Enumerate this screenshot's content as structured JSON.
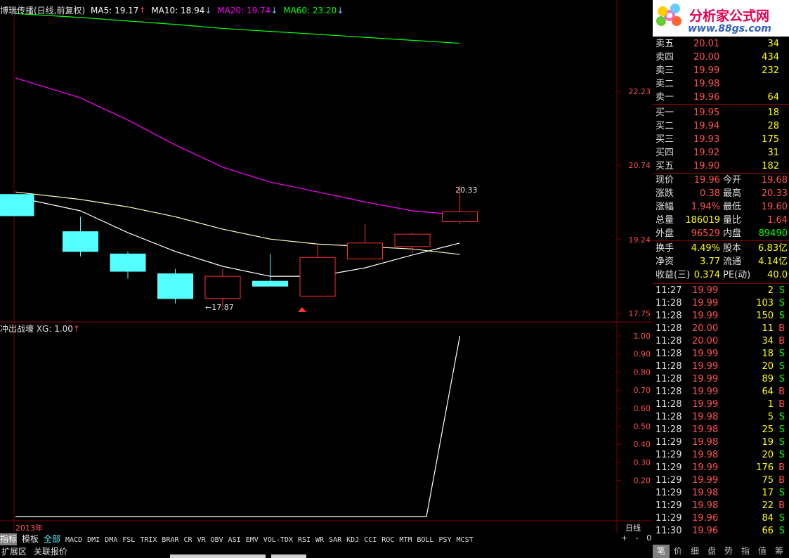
{
  "header": {
    "title": "博瑞传播(日线,前复权)",
    "ma5_label": "MA5: 19.17",
    "ma10_label": "MA10: 18.94",
    "ma20_label": "MA20: 19.74",
    "ma60_label": "MA60: 23.20",
    "ma5_color": "#ffffff",
    "ma10_color": "#ffffff",
    "ma20_color": "#ff00ff",
    "ma60_color": "#00ff00",
    "up_arrow": "↑",
    "down_arrow": "↓"
  },
  "price_axis": {
    "ticks": [
      "22.23",
      "20.74",
      "19.24",
      "17.75"
    ]
  },
  "annotations": {
    "high_label": "20.33",
    "low_label": "←17.87"
  },
  "indicator_panel": {
    "title": "冲出战壕  XG: 1.00",
    "ticks": [
      "1.00",
      "0.90",
      "0.80",
      "0.70",
      "0.60",
      "0.50",
      "0.40",
      "0.30",
      "0.20"
    ]
  },
  "bottom": {
    "year_label": "2013年",
    "period_label": "日线",
    "zoom_controls": [
      "+",
      "-",
      "0"
    ]
  },
  "indicator_tabs": [
    "指标",
    "模板",
    "全部",
    "MACD",
    "DMI",
    "DMA",
    "FSL",
    "TRIX",
    "BRAR",
    "CR",
    "VR",
    "OBV",
    "ASI",
    "EMV",
    "VOL-TDX",
    "RSI",
    "WR",
    "SAR",
    "KDJ",
    "CCI",
    "ROC",
    "MTM",
    "BOLL",
    "PSY",
    "MCST"
  ],
  "bottom_links": [
    "扩展区",
    "关联报价"
  ],
  "logo": {
    "text": "分析家公式网",
    "url": "www.88gs.com"
  },
  "order_book": {
    "asks": [
      {
        "label": "卖五",
        "price": "20.01",
        "volume": "34"
      },
      {
        "label": "卖四",
        "price": "20.00",
        "volume": "434"
      },
      {
        "label": "卖三",
        "price": "19.99",
        "volume": "232"
      },
      {
        "label": "卖二",
        "price": "19.98",
        "volume": ""
      },
      {
        "label": "卖一",
        "price": "19.96",
        "volume": "64"
      }
    ],
    "bids": [
      {
        "label": "买一",
        "price": "19.95",
        "volume": "18"
      },
      {
        "label": "买二",
        "price": "19.94",
        "volume": "28"
      },
      {
        "label": "买三",
        "price": "19.93",
        "volume": "175"
      },
      {
        "label": "买四",
        "price": "19.92",
        "volume": "31"
      },
      {
        "label": "买五",
        "price": "19.90",
        "volume": "182"
      }
    ]
  },
  "quote": [
    {
      "l1": "现价",
      "v1": "19.96",
      "l2": "今开",
      "v2": "19.68",
      "c1": "#ff5050",
      "c2": "#ff5050"
    },
    {
      "l1": "涨跌",
      "v1": "0.38",
      "l2": "最高",
      "v2": "20.33",
      "c1": "#ff5050",
      "c2": "#ff5050"
    },
    {
      "l1": "涨幅",
      "v1": "1.94%",
      "l2": "最低",
      "v2": "19.60",
      "c1": "#ff5050",
      "c2": "#ff5050"
    },
    {
      "l1": "总量",
      "v1": "186019",
      "l2": "量比",
      "v2": "1.64",
      "c1": "#ffff00",
      "c2": "#ff5050"
    },
    {
      "l1": "外盘",
      "v1": "96529",
      "l2": "内盘",
      "v2": "89490",
      "c1": "#ff5050",
      "c2": "#00ff00"
    },
    {
      "l1": "换手",
      "v1": "4.49%",
      "l2": "股本",
      "v2": "6.83亿",
      "c1": "#ffff00",
      "c2": "#ffff00"
    },
    {
      "l1": "净资",
      "v1": "3.77",
      "l2": "流通",
      "v2": "4.14亿",
      "c1": "#ffff00",
      "c2": "#ffff00"
    },
    {
      "l1": "收益(三)",
      "v1": "0.374",
      "l2": "PE(动)",
      "v2": "40.0",
      "c1": "#ffff00",
      "c2": "#ffff00"
    }
  ],
  "ticks": [
    {
      "time": "11:27",
      "price": "19.99",
      "vol": "2",
      "side": "S"
    },
    {
      "time": "11:28",
      "price": "19.99",
      "vol": "103",
      "side": "S"
    },
    {
      "time": "11:28",
      "price": "19.99",
      "vol": "150",
      "side": "S"
    },
    {
      "time": "11:28",
      "price": "20.00",
      "vol": "11",
      "side": "B"
    },
    {
      "time": "11:28",
      "price": "20.00",
      "vol": "34",
      "side": "B"
    },
    {
      "time": "11:28",
      "price": "19.99",
      "vol": "18",
      "side": "S"
    },
    {
      "time": "11:28",
      "price": "19.99",
      "vol": "20",
      "side": "S"
    },
    {
      "time": "11:28",
      "price": "19.99",
      "vol": "89",
      "side": "S"
    },
    {
      "time": "11:28",
      "price": "19.99",
      "vol": "64",
      "side": "B"
    },
    {
      "time": "11:28",
      "price": "19.99",
      "vol": "1",
      "side": "B"
    },
    {
      "time": "11:28",
      "price": "19.98",
      "vol": "5",
      "side": "S"
    },
    {
      "time": "11:28",
      "price": "19.98",
      "vol": "25",
      "side": "S"
    },
    {
      "time": "11:29",
      "price": "19.98",
      "vol": "19",
      "side": "S"
    },
    {
      "time": "11:29",
      "price": "19.98",
      "vol": "20",
      "side": "S"
    },
    {
      "time": "11:29",
      "price": "19.99",
      "vol": "176",
      "side": "B"
    },
    {
      "time": "11:29",
      "price": "19.99",
      "vol": "75",
      "side": "B"
    },
    {
      "time": "11:29",
      "price": "19.98",
      "vol": "17",
      "side": "S"
    },
    {
      "time": "11:29",
      "price": "19.98",
      "vol": "22",
      "side": "B"
    },
    {
      "time": "11:29",
      "price": "19.96",
      "vol": "84",
      "side": "S"
    },
    {
      "time": "11:30",
      "price": "19.96",
      "vol": "66",
      "side": "S"
    }
  ],
  "side_tabs": [
    "笔",
    "价",
    "细",
    "盘",
    "势",
    "指",
    "值",
    "筹"
  ],
  "chart_data": {
    "type": "candlestick",
    "y_range": [
      17.6,
      23.4
    ],
    "candles": [
      {
        "o": 20.15,
        "c": 19.72,
        "h": 20.15,
        "l": 19.72
      },
      {
        "o": 19.4,
        "c": 19.0,
        "h": 19.7,
        "l": 18.9
      },
      {
        "o": 18.95,
        "c": 18.6,
        "h": 19.0,
        "l": 18.45
      },
      {
        "o": 18.55,
        "c": 18.05,
        "h": 18.65,
        "l": 17.95
      },
      {
        "o": 18.05,
        "c": 18.5,
        "h": 18.65,
        "l": 17.87
      },
      {
        "o": 18.4,
        "c": 18.3,
        "h": 18.95,
        "l": 18.3
      },
      {
        "o": 18.1,
        "c": 18.88,
        "h": 19.15,
        "l": 18.1
      },
      {
        "o": 18.85,
        "c": 19.17,
        "h": 19.55,
        "l": 18.85
      },
      {
        "o": 19.1,
        "c": 19.35,
        "h": 19.38,
        "l": 18.97
      },
      {
        "o": 19.6,
        "c": 19.8,
        "h": 20.33,
        "l": 19.55
      }
    ],
    "ma5": [
      20.1,
      19.82,
      19.38,
      19.0,
      18.7,
      18.5,
      18.5,
      18.67,
      18.93,
      19.17
    ],
    "ma10": [
      20.2,
      20.05,
      19.9,
      19.7,
      19.45,
      19.25,
      19.15,
      19.1,
      19.05,
      18.94
    ],
    "ma20": [
      22.5,
      22.1,
      21.65,
      21.15,
      20.7,
      20.4,
      20.2,
      20.0,
      19.82,
      19.74
    ],
    "ma60": [
      23.8,
      23.72,
      23.65,
      23.58,
      23.5,
      23.44,
      23.38,
      23.32,
      23.26,
      23.2
    ],
    "xg": [
      0,
      0,
      0,
      0,
      0,
      0,
      0,
      0,
      0,
      1
    ]
  }
}
